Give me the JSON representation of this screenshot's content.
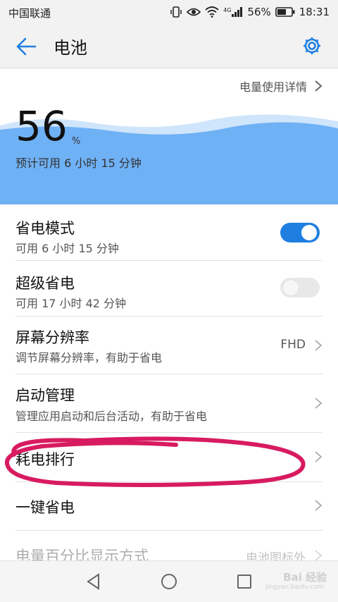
{
  "status": {
    "carrier": "中国联通",
    "network": "4G",
    "battery_percent": "56%",
    "time": "18:31"
  },
  "header": {
    "title": "电池"
  },
  "detail_link": "电量使用详情",
  "battery": {
    "level": "56",
    "unit": "%",
    "estimate": "预计可用 6 小时 15 分钟",
    "wave_color": "#6fb1f5"
  },
  "items": [
    {
      "title": "省电模式",
      "subtitle": "可用 6 小时 15 分钟",
      "toggle": "on"
    },
    {
      "title": "超级省电",
      "subtitle": "可用 17 小时 42 分钟",
      "toggle": "off"
    },
    {
      "title": "屏幕分辨率",
      "subtitle": "调节屏幕分辨率，有助于省电",
      "value": "FHD"
    },
    {
      "title": "启动管理",
      "subtitle": "管理应用启动和后台活动，有助于省电"
    },
    {
      "title": "耗电排行"
    },
    {
      "title": "一键省电"
    },
    {
      "title": "电量百分比显示方式",
      "value": "电池图标外"
    }
  ],
  "watermark": {
    "brand": "Bai 经验",
    "url": "jingyan.baidu.com"
  },
  "colors": {
    "accent": "#1f7fe0",
    "highlight_ring": "#d81b60"
  }
}
